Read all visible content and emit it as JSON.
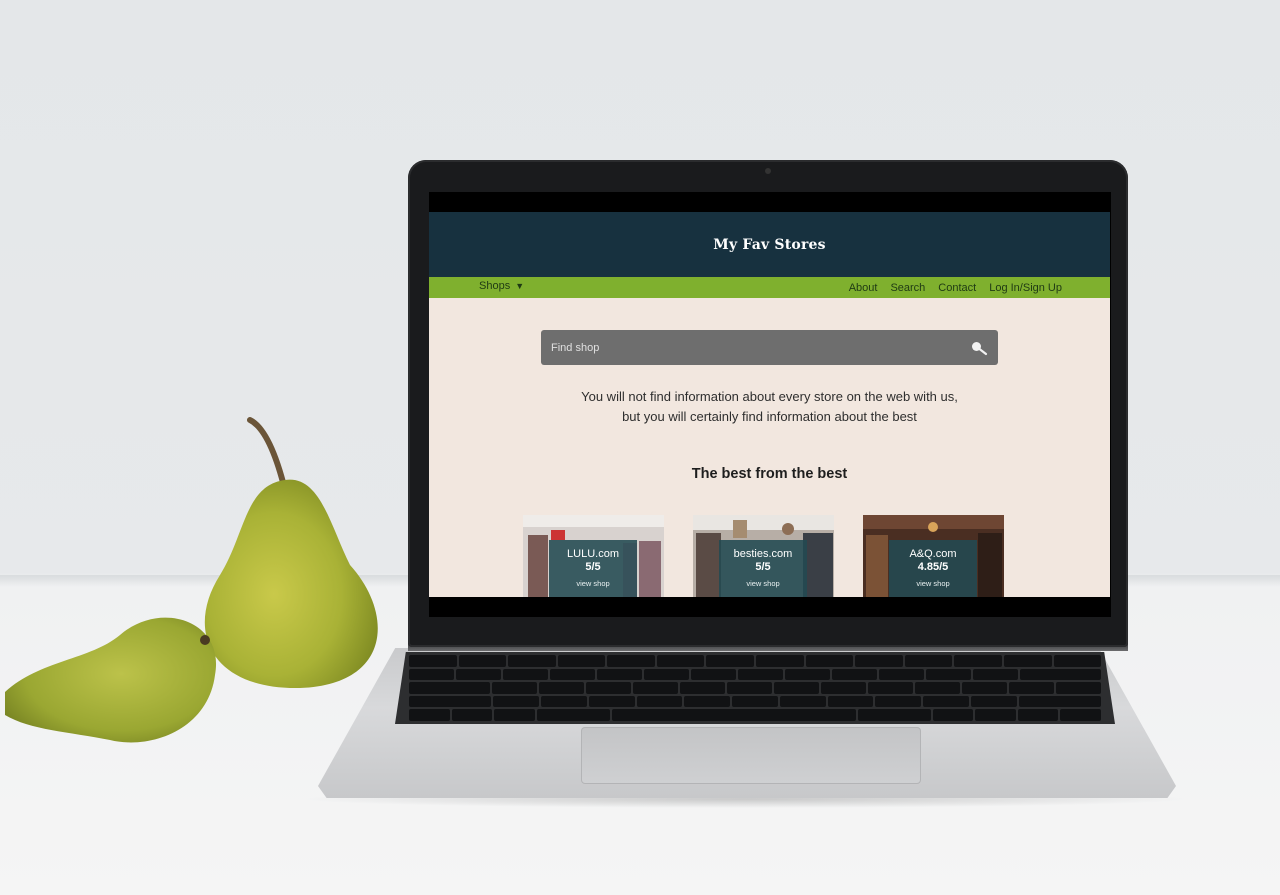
{
  "site": {
    "title": "My Fav Stores",
    "nav": {
      "shops_label": "Shops",
      "links": [
        "About",
        "Search",
        "Contact",
        "Log In/Sign Up"
      ]
    },
    "search": {
      "placeholder": "Find shop"
    },
    "intro_line1": "You will not find information about every store on the web with us,",
    "intro_line2": "but you will certainly find information about the best",
    "section_title": "The best from the best",
    "shops": [
      {
        "name": "LULU.com",
        "rating": "5/5",
        "link": "view shop"
      },
      {
        "name": "besties.com",
        "rating": "5/5",
        "link": "view shop"
      },
      {
        "name": "A&Q.com",
        "rating": "4.85/5",
        "link": "view shop"
      }
    ]
  },
  "colors": {
    "header": "#17313f",
    "nav": "#7fb02e",
    "page_bg": "#f2e7df",
    "search_bg": "#6e6e6e",
    "card_overlay": "#224a52"
  },
  "icons": {
    "search": "search-icon",
    "dropdown": "caret-down-icon"
  }
}
